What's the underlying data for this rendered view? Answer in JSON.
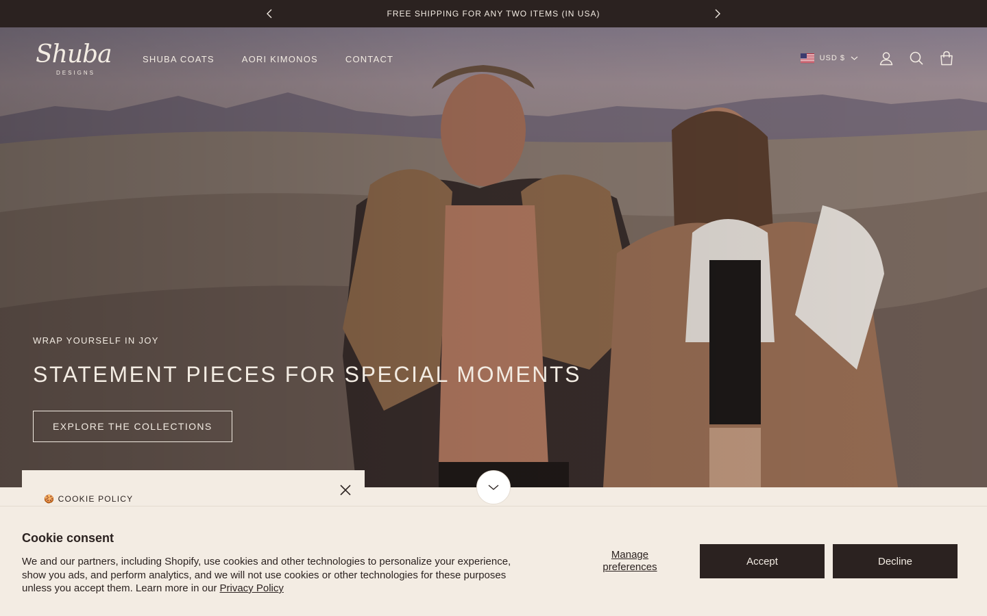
{
  "announcement": {
    "text": "FREE SHIPPING FOR ANY TWO ITEMS (IN USA)",
    "prev_icon": "chevron-left-icon",
    "next_icon": "chevron-right-icon"
  },
  "header": {
    "logo_script": "Shuba",
    "logo_sub": "DESIGNS",
    "nav": [
      "SHUBA COATS",
      "AORI KIMONOS",
      "CONTACT"
    ],
    "currency": "USD $",
    "icons": [
      "us-flag-icon",
      "chevron-down-icon",
      "account-icon",
      "search-icon",
      "cart-icon"
    ]
  },
  "hero": {
    "kicker": "WRAP YOURSELF IN JOY",
    "headline": "STATEMENT PIECES FOR SPECIAL MOMENTS",
    "cta": "EXPLORE THE COLLECTIONS"
  },
  "cookie_policy": {
    "title": "🍪 COOKIE POLICY"
  },
  "consent": {
    "title": "Cookie consent",
    "body": "We and our partners, including Shopify, use cookies and other technologies to personalize your experience, show you ads, and perform analytics, and we will not use cookies or other technologies for these purposes unless you accept them. Learn more in our ",
    "privacy_link": "Privacy Policy",
    "manage": "Manage preferences",
    "accept": "Accept",
    "decline": "Decline"
  },
  "colors": {
    "dark": "#2b2220",
    "cream": "#f3ece3"
  }
}
